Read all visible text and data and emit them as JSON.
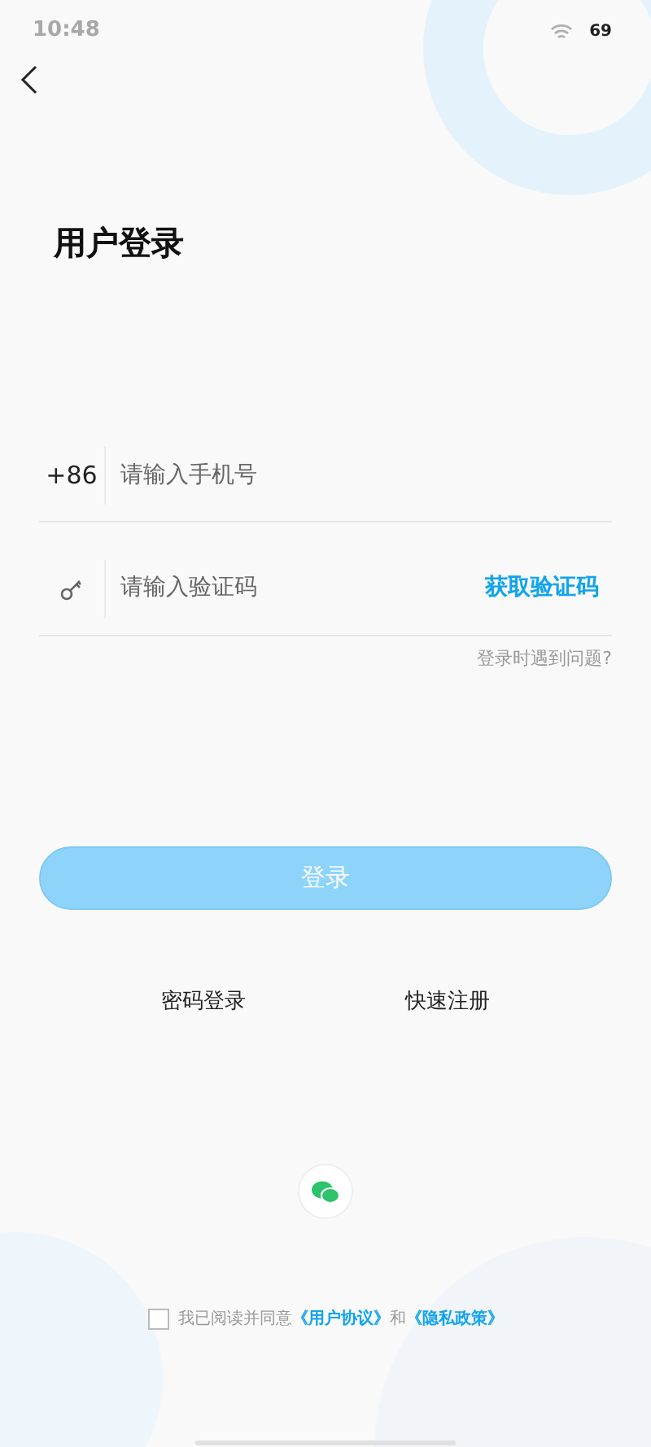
{
  "status_bar": {
    "time": "10:48",
    "battery": "69"
  },
  "title": "用户登录",
  "phone_field": {
    "prefix": "+86",
    "placeholder": "请输入手机号"
  },
  "code_field": {
    "placeholder": "请输入验证码",
    "action": "获取验证码"
  },
  "help_link": "登录时遇到问题?",
  "login_button": {
    "label": "登录",
    "disabled": true
  },
  "alt_links": [
    "密码登录",
    "快速注册"
  ],
  "agreement": {
    "checked": false,
    "text": "我已阅读并同意",
    "link_1": "《用户协议》",
    "joiner": "和",
    "link_2": "《隐私政策》"
  }
}
